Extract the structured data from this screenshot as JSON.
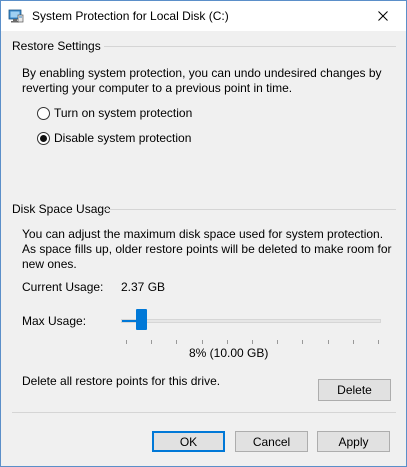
{
  "window": {
    "title": "System Protection for Local Disk (C:)"
  },
  "restore_settings": {
    "heading": "Restore Settings",
    "description": "By enabling system protection, you can undo undesired changes by reverting your computer to a previous point in time.",
    "options": [
      {
        "label": "Turn on system protection",
        "selected": false
      },
      {
        "label": "Disable system protection",
        "selected": true
      }
    ]
  },
  "disk_space": {
    "heading": "Disk Space Usage",
    "description": "You can adjust the maximum disk space used for system protection. As space fills up, older restore points will be deleted to make room for new ones.",
    "current_usage_label": "Current Usage:",
    "current_usage_value": "2.37 GB",
    "max_usage_label": "Max Usage:",
    "max_usage_percent": 8,
    "max_usage_value": "8% (10.00 GB)",
    "delete_text": "Delete all restore points for this drive.",
    "delete_button": "Delete"
  },
  "footer": {
    "ok": "OK",
    "cancel": "Cancel",
    "apply": "Apply"
  },
  "colors": {
    "accent": "#0078d7",
    "border": "#5b8fc9"
  },
  "icons": {
    "title": "system-protection-icon",
    "close": "close-icon"
  }
}
